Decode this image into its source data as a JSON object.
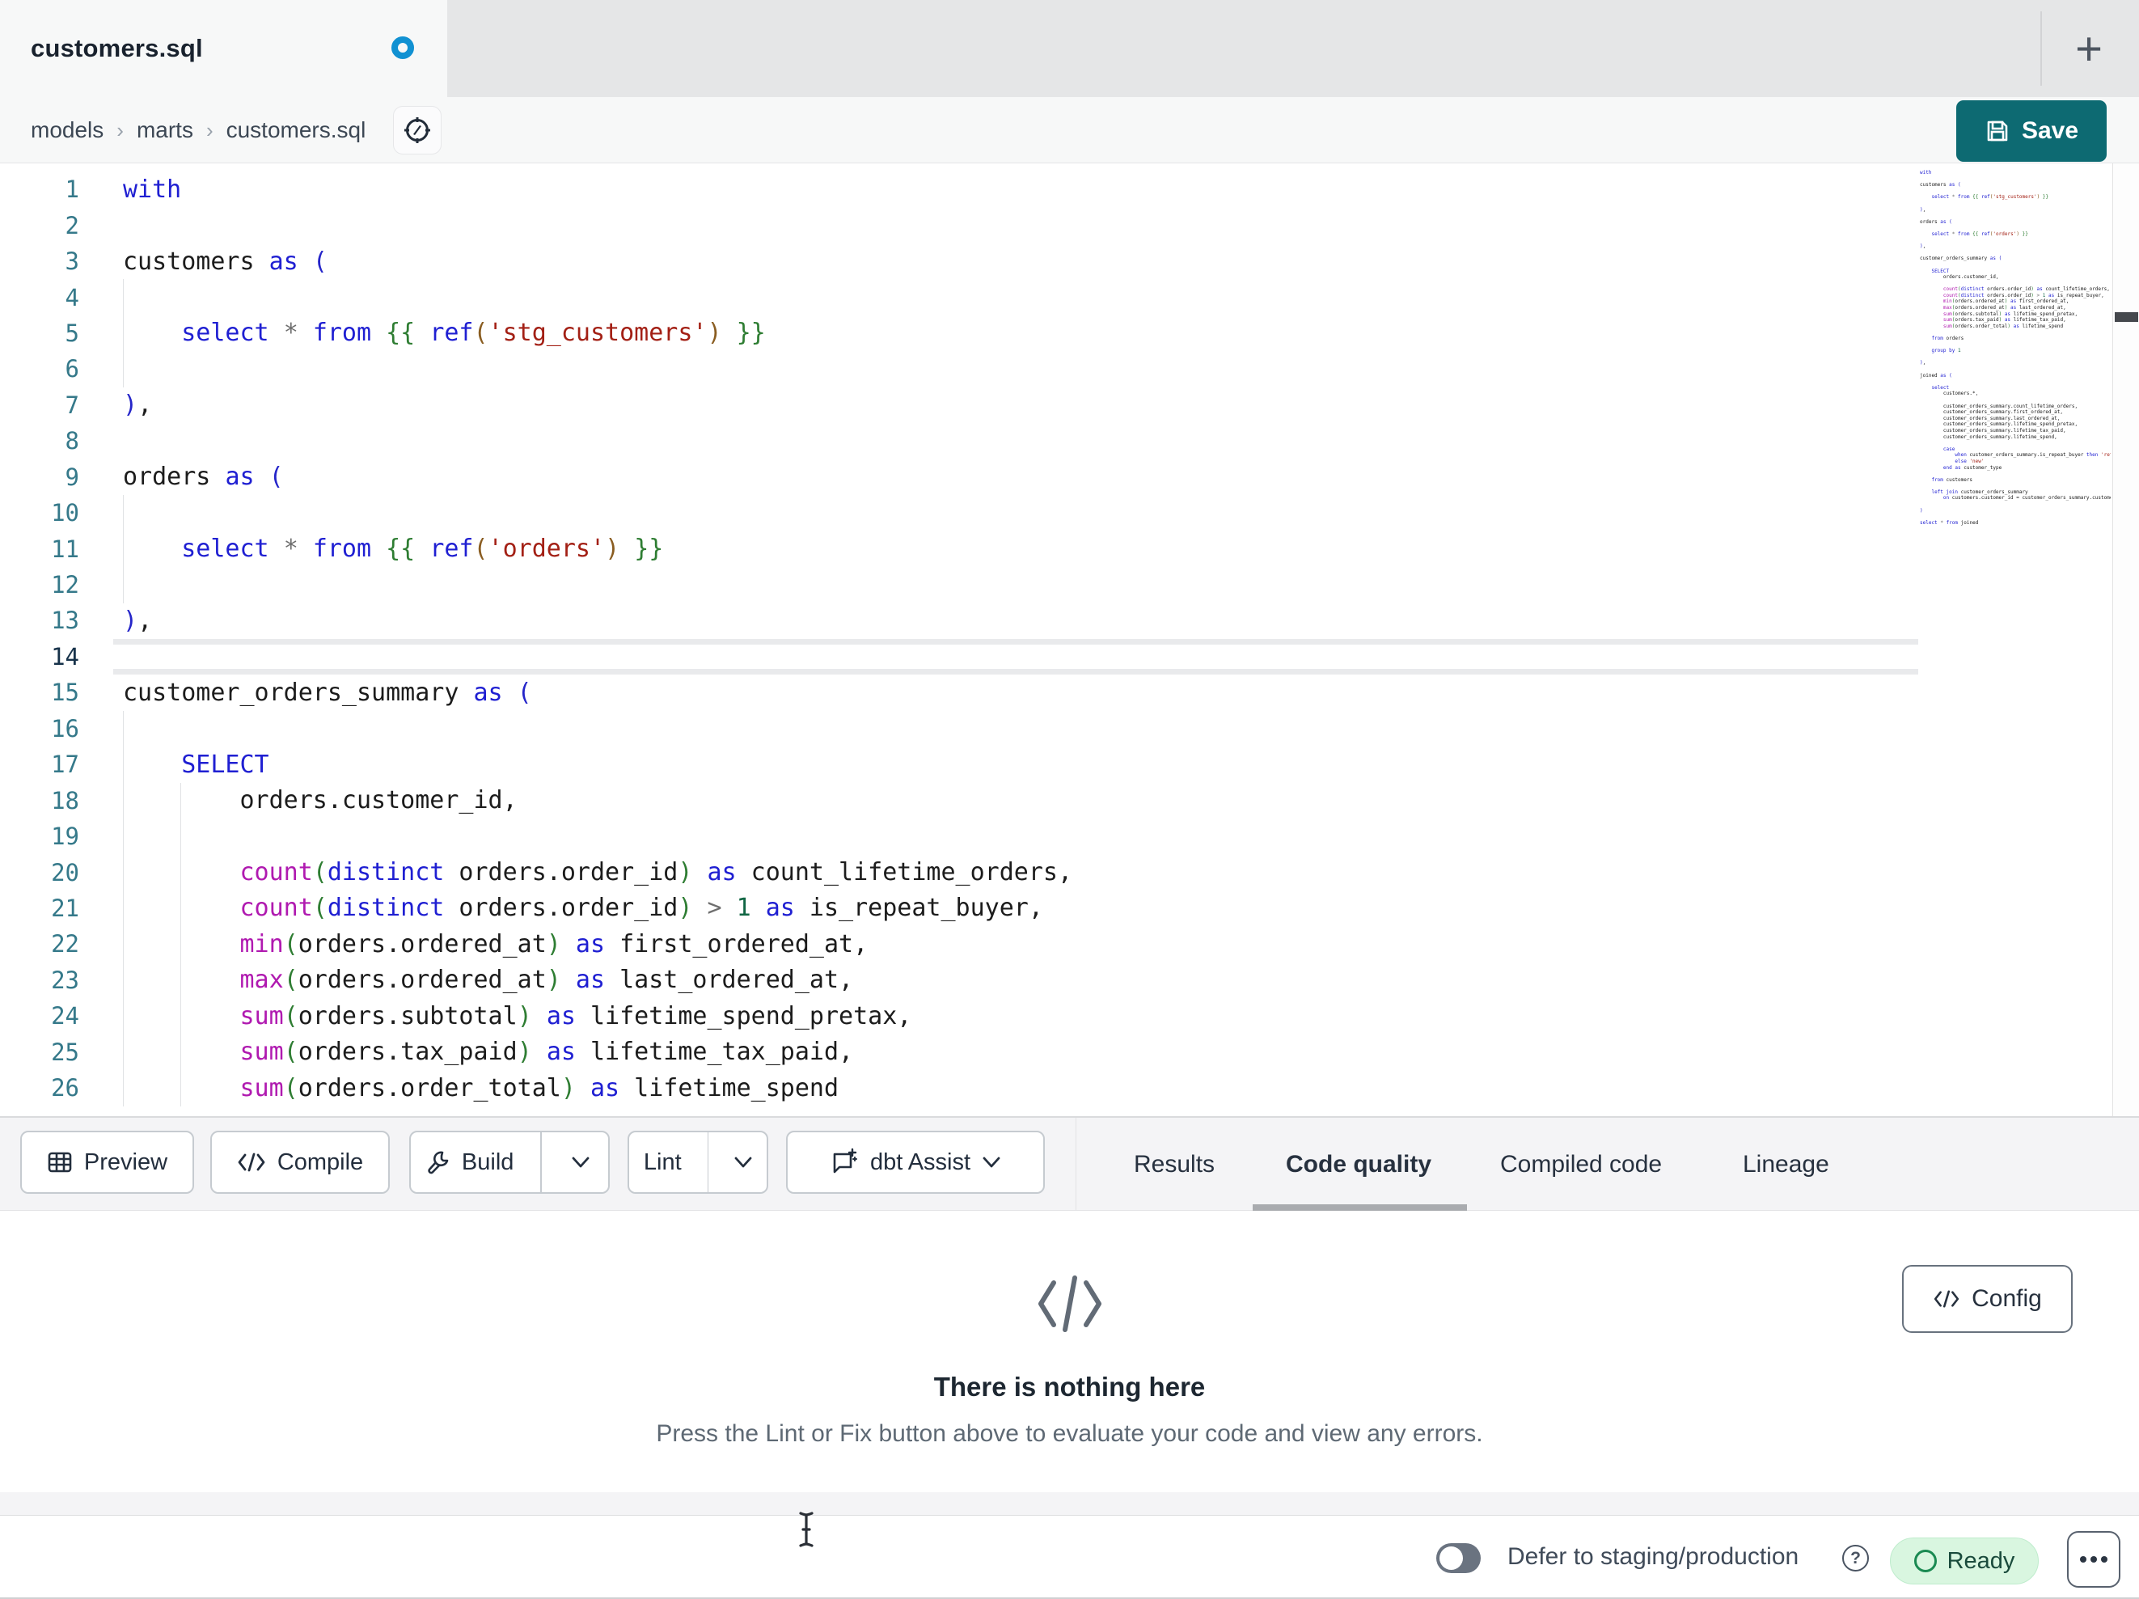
{
  "tab_bar": {
    "active_tab": "customers.sql",
    "unsaved_indicator": true,
    "new_tab_label": "+"
  },
  "breadcrumb": {
    "items": [
      "models",
      "marts",
      "customers.sql"
    ],
    "separator": "›"
  },
  "save_button": {
    "label": "Save",
    "bg": "#0d6a72"
  },
  "toolbar": {
    "preview": "Preview",
    "compile": "Compile",
    "build": "Build",
    "lint": "Lint",
    "dbt_assist": "dbt Assist"
  },
  "result_tabs": {
    "items": [
      "Results",
      "Code quality",
      "Compiled code",
      "Lineage"
    ],
    "active": "Code quality"
  },
  "empty_state": {
    "title": "There is nothing here",
    "subtitle": "Press the Lint or Fix button above to evaluate your code and view any errors.",
    "config_label": "Config"
  },
  "status_bar": {
    "defer_label": "Defer to staging/production",
    "defer_enabled": false,
    "ready_label": "Ready",
    "ready_colors": {
      "bg": "#d9f6e0",
      "text": "#1a4b3c",
      "icon": "#1a8a52"
    }
  },
  "editor": {
    "active_line": 14,
    "visible_lines": 26,
    "gutter_color": "#35798a",
    "token_colors": {
      "kw": "#1f1fd2",
      "fn": "#b01ab0",
      "str": "#a32015",
      "jinja": "#2e7d32",
      "jp": "#8a5d21",
      "p1": "#2525c9",
      "p2": "#2e7d32",
      "num": "#116644",
      "op": "#6f6f6f",
      "txt": "#1c1c1c"
    },
    "lines": [
      [
        [
          "kw",
          "with"
        ]
      ],
      [],
      [
        [
          "txt",
          "customers "
        ],
        [
          "kw",
          "as"
        ],
        [
          "txt",
          " "
        ],
        [
          "p1",
          "("
        ]
      ],
      [],
      [
        [
          "txt",
          "    "
        ],
        [
          "kw",
          "select"
        ],
        [
          "txt",
          " "
        ],
        [
          "op",
          "*"
        ],
        [
          "txt",
          " "
        ],
        [
          "kw",
          "from"
        ],
        [
          "txt",
          " "
        ],
        [
          "jinja",
          "{{"
        ],
        [
          "txt",
          " "
        ],
        [
          "kw",
          "ref"
        ],
        [
          "jp",
          "("
        ],
        [
          "str",
          "'stg_customers'"
        ],
        [
          "jp",
          ")"
        ],
        [
          "txt",
          " "
        ],
        [
          "jinja",
          "}}"
        ]
      ],
      [],
      [
        [
          "p1",
          ")"
        ],
        [
          "txt",
          ","
        ]
      ],
      [],
      [
        [
          "txt",
          "orders "
        ],
        [
          "kw",
          "as"
        ],
        [
          "txt",
          " "
        ],
        [
          "p1",
          "("
        ]
      ],
      [],
      [
        [
          "txt",
          "    "
        ],
        [
          "kw",
          "select"
        ],
        [
          "txt",
          " "
        ],
        [
          "op",
          "*"
        ],
        [
          "txt",
          " "
        ],
        [
          "kw",
          "from"
        ],
        [
          "txt",
          " "
        ],
        [
          "jinja",
          "{{"
        ],
        [
          "txt",
          " "
        ],
        [
          "kw",
          "ref"
        ],
        [
          "jp",
          "("
        ],
        [
          "str",
          "'orders'"
        ],
        [
          "jp",
          ")"
        ],
        [
          "txt",
          " "
        ],
        [
          "jinja",
          "}}"
        ]
      ],
      [],
      [
        [
          "p1",
          ")"
        ],
        [
          "txt",
          ","
        ]
      ],
      [],
      [
        [
          "txt",
          "customer_orders_summary "
        ],
        [
          "kw",
          "as"
        ],
        [
          "txt",
          " "
        ],
        [
          "p1",
          "("
        ]
      ],
      [],
      [
        [
          "txt",
          "    "
        ],
        [
          "kw",
          "SELECT"
        ]
      ],
      [
        [
          "txt",
          "        orders.customer_id,"
        ]
      ],
      [],
      [
        [
          "txt",
          "        "
        ],
        [
          "fn",
          "count"
        ],
        [
          "p2",
          "("
        ],
        [
          "kw",
          "distinct"
        ],
        [
          "txt",
          " orders.order_id"
        ],
        [
          "p2",
          ")"
        ],
        [
          "txt",
          " "
        ],
        [
          "kw",
          "as"
        ],
        [
          "txt",
          " count_lifetime_orders,"
        ]
      ],
      [
        [
          "txt",
          "        "
        ],
        [
          "fn",
          "count"
        ],
        [
          "p2",
          "("
        ],
        [
          "kw",
          "distinct"
        ],
        [
          "txt",
          " orders.order_id"
        ],
        [
          "p2",
          ")"
        ],
        [
          "txt",
          " "
        ],
        [
          "op",
          ">"
        ],
        [
          "txt",
          " "
        ],
        [
          "num",
          "1"
        ],
        [
          "txt",
          " "
        ],
        [
          "kw",
          "as"
        ],
        [
          "txt",
          " is_repeat_buyer,"
        ]
      ],
      [
        [
          "txt",
          "        "
        ],
        [
          "fn",
          "min"
        ],
        [
          "p2",
          "("
        ],
        [
          "txt",
          "orders.ordered_at"
        ],
        [
          "p2",
          ")"
        ],
        [
          "txt",
          " "
        ],
        [
          "kw",
          "as"
        ],
        [
          "txt",
          " first_ordered_at,"
        ]
      ],
      [
        [
          "txt",
          "        "
        ],
        [
          "fn",
          "max"
        ],
        [
          "p2",
          "("
        ],
        [
          "txt",
          "orders.ordered_at"
        ],
        [
          "p2",
          ")"
        ],
        [
          "txt",
          " "
        ],
        [
          "kw",
          "as"
        ],
        [
          "txt",
          " last_ordered_at,"
        ]
      ],
      [
        [
          "txt",
          "        "
        ],
        [
          "fn",
          "sum"
        ],
        [
          "p2",
          "("
        ],
        [
          "txt",
          "orders.subtotal"
        ],
        [
          "p2",
          ")"
        ],
        [
          "txt",
          " "
        ],
        [
          "kw",
          "as"
        ],
        [
          "txt",
          " lifetime_spend_pretax,"
        ]
      ],
      [
        [
          "txt",
          "        "
        ],
        [
          "fn",
          "sum"
        ],
        [
          "p2",
          "("
        ],
        [
          "txt",
          "orders.tax_paid"
        ],
        [
          "p2",
          ")"
        ],
        [
          "txt",
          " "
        ],
        [
          "kw",
          "as"
        ],
        [
          "txt",
          " lifetime_tax_paid,"
        ]
      ],
      [
        [
          "txt",
          "        "
        ],
        [
          "fn",
          "sum"
        ],
        [
          "p2",
          "("
        ],
        [
          "txt",
          "orders.order_total"
        ],
        [
          "p2",
          ")"
        ],
        [
          "txt",
          " "
        ],
        [
          "kw",
          "as"
        ],
        [
          "txt",
          " lifetime_spend"
        ]
      ],
      [],
      [
        [
          "txt",
          "    "
        ],
        [
          "kw",
          "from"
        ],
        [
          "txt",
          " orders"
        ]
      ],
      [],
      [
        [
          "txt",
          "    "
        ],
        [
          "kw",
          "group by"
        ],
        [
          "txt",
          " "
        ],
        [
          "num",
          "1"
        ]
      ],
      [],
      [
        [
          "p1",
          ")"
        ],
        [
          "txt",
          ","
        ]
      ],
      [],
      [
        [
          "txt",
          "joined "
        ],
        [
          "kw",
          "as"
        ],
        [
          "txt",
          " "
        ],
        [
          "p1",
          "("
        ]
      ],
      [],
      [
        [
          "txt",
          "    "
        ],
        [
          "kw",
          "select"
        ]
      ],
      [
        [
          "txt",
          "        customers.*,"
        ]
      ],
      [],
      [
        [
          "txt",
          "        customer_orders_summary.count_lifetime_orders,"
        ]
      ],
      [
        [
          "txt",
          "        customer_orders_summary.first_ordered_at,"
        ]
      ],
      [
        [
          "txt",
          "        customer_orders_summary.last_ordered_at,"
        ]
      ],
      [
        [
          "txt",
          "        customer_orders_summary.lifetime_spend_pretax,"
        ]
      ],
      [
        [
          "txt",
          "        customer_orders_summary.lifetime_tax_paid,"
        ]
      ],
      [
        [
          "txt",
          "        customer_orders_summary.lifetime_spend,"
        ]
      ],
      [],
      [
        [
          "txt",
          "        "
        ],
        [
          "kw",
          "case"
        ]
      ],
      [
        [
          "txt",
          "            "
        ],
        [
          "kw",
          "when"
        ],
        [
          "txt",
          " customer_orders_summary.is_repeat_buyer "
        ],
        [
          "kw",
          "then"
        ],
        [
          "txt",
          " "
        ],
        [
          "str",
          "'returning'"
        ]
      ],
      [
        [
          "txt",
          "            "
        ],
        [
          "kw",
          "else"
        ],
        [
          "txt",
          " "
        ],
        [
          "str",
          "'new'"
        ]
      ],
      [
        [
          "txt",
          "        "
        ],
        [
          "kw",
          "end"
        ],
        [
          "txt",
          " "
        ],
        [
          "kw",
          "as"
        ],
        [
          "txt",
          " customer_type"
        ]
      ],
      [],
      [
        [
          "txt",
          "    "
        ],
        [
          "kw",
          "from"
        ],
        [
          "txt",
          " customers"
        ]
      ],
      [],
      [
        [
          "txt",
          "    "
        ],
        [
          "kw",
          "left join"
        ],
        [
          "txt",
          " customer_orders_summary"
        ]
      ],
      [
        [
          "txt",
          "        "
        ],
        [
          "kw",
          "on"
        ],
        [
          "txt",
          " customers.customer_id = customer_orders_summary.customer_id"
        ]
      ],
      [],
      [
        [
          "p1",
          ")"
        ]
      ],
      [],
      [
        [
          "kw",
          "select"
        ],
        [
          "txt",
          " "
        ],
        [
          "op",
          "*"
        ],
        [
          "txt",
          " "
        ],
        [
          "kw",
          "from"
        ],
        [
          "txt",
          " joined"
        ]
      ]
    ]
  }
}
